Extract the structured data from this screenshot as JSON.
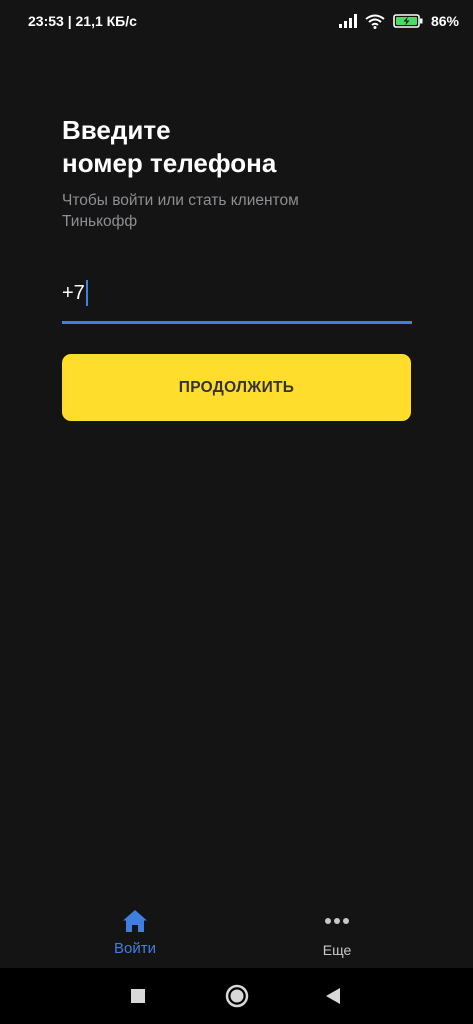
{
  "status_bar": {
    "time_speed": "23:53 | 21,1 КБ/с",
    "battery_percent": "86%",
    "icons": [
      "signal-icon",
      "wifi-icon",
      "battery-charging-icon"
    ]
  },
  "login": {
    "title": "Введите\nномер телефона",
    "subtitle": "Чтобы войти или стать клиентом\nТинькофф",
    "phone_value": "+7",
    "continue_label": "ПРОДОЛЖИТЬ"
  },
  "tabs": [
    {
      "label": "Войти",
      "icon": "home-icon",
      "active": true
    },
    {
      "label": "Еще",
      "icon": "more-dots-icon",
      "active": false
    }
  ],
  "colors": {
    "background": "#141414",
    "accent_blue": "#3f7fe0",
    "button_yellow": "#ffdd2d",
    "subtitle_gray": "#8e8e93"
  },
  "nav_bar": {
    "icons": [
      "recents-square-icon",
      "home-circle-icon",
      "back-triangle-icon"
    ]
  }
}
